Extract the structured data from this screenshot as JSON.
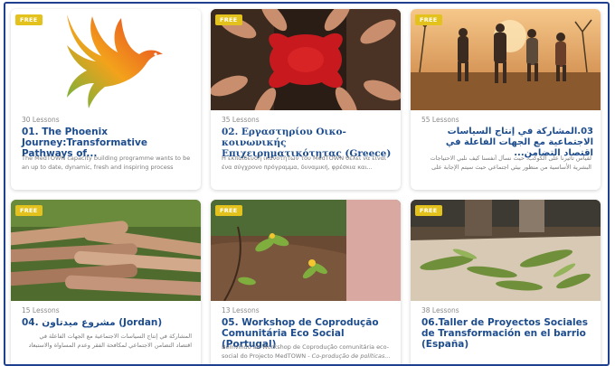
{
  "courses": [
    {
      "badge": "FREE",
      "lessons": "30 Lessons",
      "title": "01. The Phoenix Journey:Transformative Pathways of...",
      "description": "The MedTOWN capacity building programme wants to be an up to date, dynamic, fresh and inspiring process that..."
    },
    {
      "badge": "FREE",
      "lessons": "35 Lessons",
      "title": "02. Εργαστηρίου Οικο-κοινωνικής Επιχειρηματικότητας (Greece)",
      "description": "Η εκπαίδευση ικανοτήτων του MedTOWN θέλει να είναι ένα σύγχρονο πρόγραμμα, δυναμική, φρέσκια και..."
    },
    {
      "badge": "FREE",
      "lessons": "55 Lessons",
      "title": "03.المشاركة في إنتاج السياسات الاجتماعية مع الجهات الفاعلة في اقتصاد التضامن...",
      "description": "لقياس تأثيرنا على الكوكب، حيث نسأل أنفسنا كيف نلبي الاحتياجات البشرية الأساسية من منظور بيئي اجتماعي حيث سيتم الإجابة على التساؤلات التالية"
    },
    {
      "badge": "FREE",
      "lessons": "15 Lessons",
      "title": "04. مشروع ميدتاون (Jordan)",
      "description": "المشاركة في إنتاج السياسات الاجتماعية مع الجهات الفاعلة في اقتصاد التضامن الاجتماعي لمكافحة الفقر وعدم المساواة والاستبعاد الاجتماعي..."
    },
    {
      "badge": "FREE",
      "lessons": "13 Lessons",
      "title": "05. Workshop de Coprodução Comunitária Eco Social (Portugal)",
      "description": "Bemvindo ao Workshop de Coprodução comunitária eco-social do Projecto MedTOWN -",
      "description_italic": "Co-produção de políticas..."
    },
    {
      "badge": "FREE",
      "lessons": "38 Lessons",
      "title": "06.Taller de Proyectos Sociales de Transformación en el barrio (España)",
      "description": ""
    }
  ],
  "colors": {
    "title": "#1d4c8d",
    "badge": "#e4c21d",
    "frame_border": "#1f3f8f",
    "muted_text": "#8a8a8a"
  }
}
